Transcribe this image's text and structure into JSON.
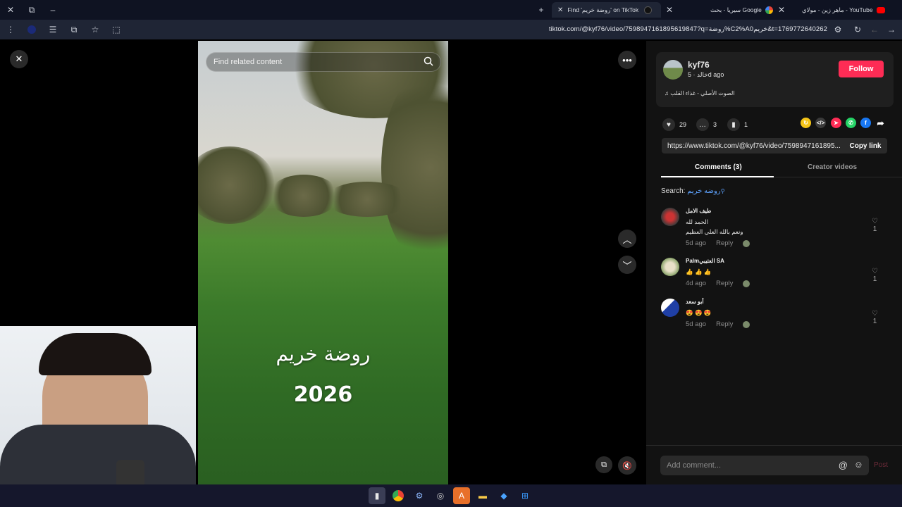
{
  "browser": {
    "tabs": [
      {
        "title": "Find 'روضة خريم' on TikTok | Ti",
        "active": true
      },
      {
        "title": "سيريا - بحث Google",
        "active": false
      },
      {
        "title": "ماهر زين - مولاي - YouTube",
        "active": false
      }
    ],
    "url": "tiktok.com/@kyf76/video/7598947161895619847?q=روضة%C2%A0خريم&t=1769772640262"
  },
  "video": {
    "search_placeholder": "Find related content",
    "overlay_line1": "روضة خريم",
    "overlay_line2": "2026"
  },
  "author": {
    "username": "kyf76",
    "nickname": "خالد",
    "time": "5d ago",
    "follow_label": "Follow",
    "sound": "الصوت الأصلي - غذاء القلب"
  },
  "stats": {
    "likes": "29",
    "comments": "3",
    "saves": "1"
  },
  "share": {
    "link": "https://www.tiktok.com/@kyf76/video/7598947161895...",
    "copy_label": "Copy link",
    "icon_colors": [
      "#f5c518",
      "#3a3a3a",
      "#fe2c55",
      "#25d366",
      "#1877f2"
    ]
  },
  "panel_tabs": {
    "comments": "Comments (3)",
    "creator": "Creator videos"
  },
  "search": {
    "label": "Search:",
    "term": "روضه خريم"
  },
  "comments": [
    {
      "name": "طيف الامل",
      "lines": [
        "الحمد لله",
        "ونعم بالله العلي العظيم"
      ],
      "time": "5d ago",
      "reply": "Reply",
      "likes": "1"
    },
    {
      "name": "Palmالعتيبي SA",
      "lines": [
        "👍 👍 👍"
      ],
      "time": "4d ago",
      "reply": "Reply",
      "likes": "1"
    },
    {
      "name": "أبو سعد",
      "lines": [
        "😍 😍 😍"
      ],
      "time": "5d ago",
      "reply": "Reply",
      "likes": "1"
    }
  ],
  "composer": {
    "placeholder": "Add comment...",
    "post": "Post"
  }
}
